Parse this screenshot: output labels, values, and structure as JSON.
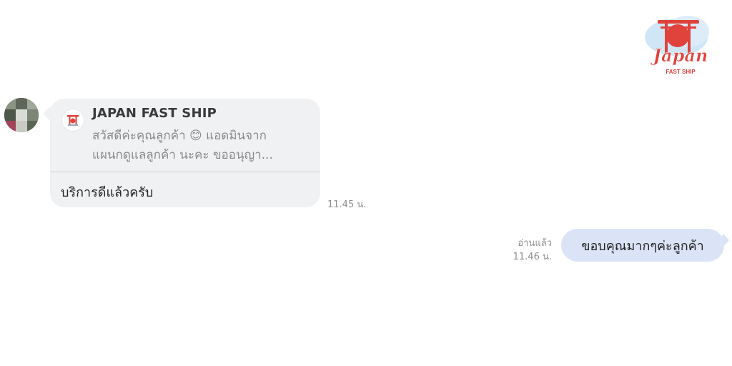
{
  "brand": {
    "logo_script": "Japan",
    "logo_subtitle": "FAST SHIP"
  },
  "colors": {
    "incoming_bubble": "#f0f1f3",
    "outgoing_bubble": "#dbe4f6",
    "timestamp": "#8e8e8e",
    "logo_red": "#e0423c"
  },
  "chat": {
    "incoming": {
      "reply_to": {
        "sender": "JAPAN FAST SHIP",
        "preview_line1": "สวัสดีค่ะคุณลูกค้า 😊 แอดมินจาก",
        "preview_line2": "แผนกดูแลลูกค้า นะคะ ขออนุญา..."
      },
      "text": "บริการดีแล้วครับ",
      "time": "11.45 น."
    },
    "outgoing": {
      "read_status": "อ่านแล้ว",
      "time": "11.46 น.",
      "text": "ขอบคุณมากๆค่ะลูกค้า"
    }
  }
}
